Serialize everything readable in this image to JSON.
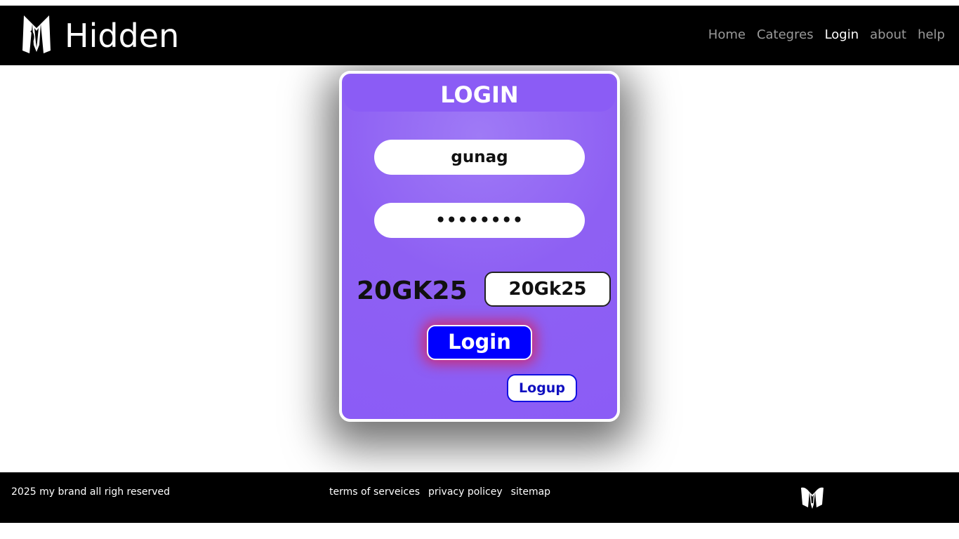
{
  "header": {
    "brand": "Hidden",
    "logo_icon": "tuxedo-logo-icon",
    "nav": [
      "Home",
      "Categres",
      "Login",
      "about",
      "help"
    ],
    "active_nav": "Login"
  },
  "login_card": {
    "title": "LOGIN",
    "username_value": "gunag",
    "password_value": "••••••••",
    "captcha_code": "20GK25",
    "captcha_input_value": "20Gk25",
    "login_button": "Login",
    "logup_button": "Logup"
  },
  "footer": {
    "copyright": "2025 my brand all righ reserved",
    "links": [
      "terms of serveices",
      "privacy policey",
      "sitemap"
    ],
    "logo_icon": "tuxedo-logo-icon"
  },
  "colors": {
    "header_bg": "#000000",
    "card_purple": "#8b5cf6",
    "login_button": "#0000ff",
    "login_glow": "#dc1e50"
  }
}
